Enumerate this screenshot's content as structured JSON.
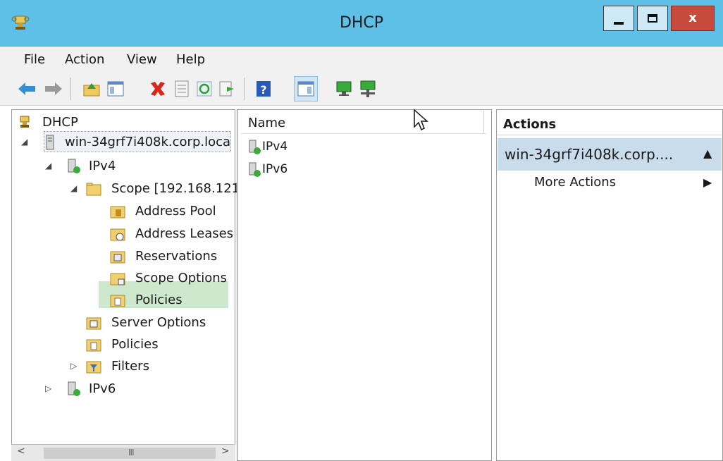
{
  "window": {
    "title": "DHCP",
    "icon": "dhcp-trophy-icon",
    "close_glyph": "x",
    "accent_color": "#5ec0e6"
  },
  "menu": [
    "File",
    "Action",
    "View",
    "Help"
  ],
  "toolbar": {
    "icons": [
      "back-arrow-icon",
      "forward-arrow-icon",
      "up-folder-icon",
      "show-hide-tree-icon",
      "delete-icon",
      "properties-icon",
      "refresh-icon",
      "export-list-icon",
      "help-icon",
      "show-hide-action-pane-icon",
      "computer-monitor-icon",
      "computer-network-icon"
    ]
  },
  "tree": {
    "root": "DHCP",
    "server": "win-34grf7i408k.corp.loca",
    "ipv4": "IPv4",
    "scope": "Scope [192.168.121",
    "scope_children": [
      "Address Pool",
      "Address Leases",
      "Reservations",
      "Scope Options",
      "Policies"
    ],
    "server_options": "Server Options",
    "policies": "Policies",
    "filters": "Filters",
    "ipv6": "IPv6",
    "scroll_grip": "III"
  },
  "list": {
    "column_name": "Name",
    "items": [
      "IPv4",
      "IPv6"
    ]
  },
  "actions": {
    "header": "Actions",
    "group": "win-34grf7i408k.corp....",
    "more": "More Actions"
  }
}
